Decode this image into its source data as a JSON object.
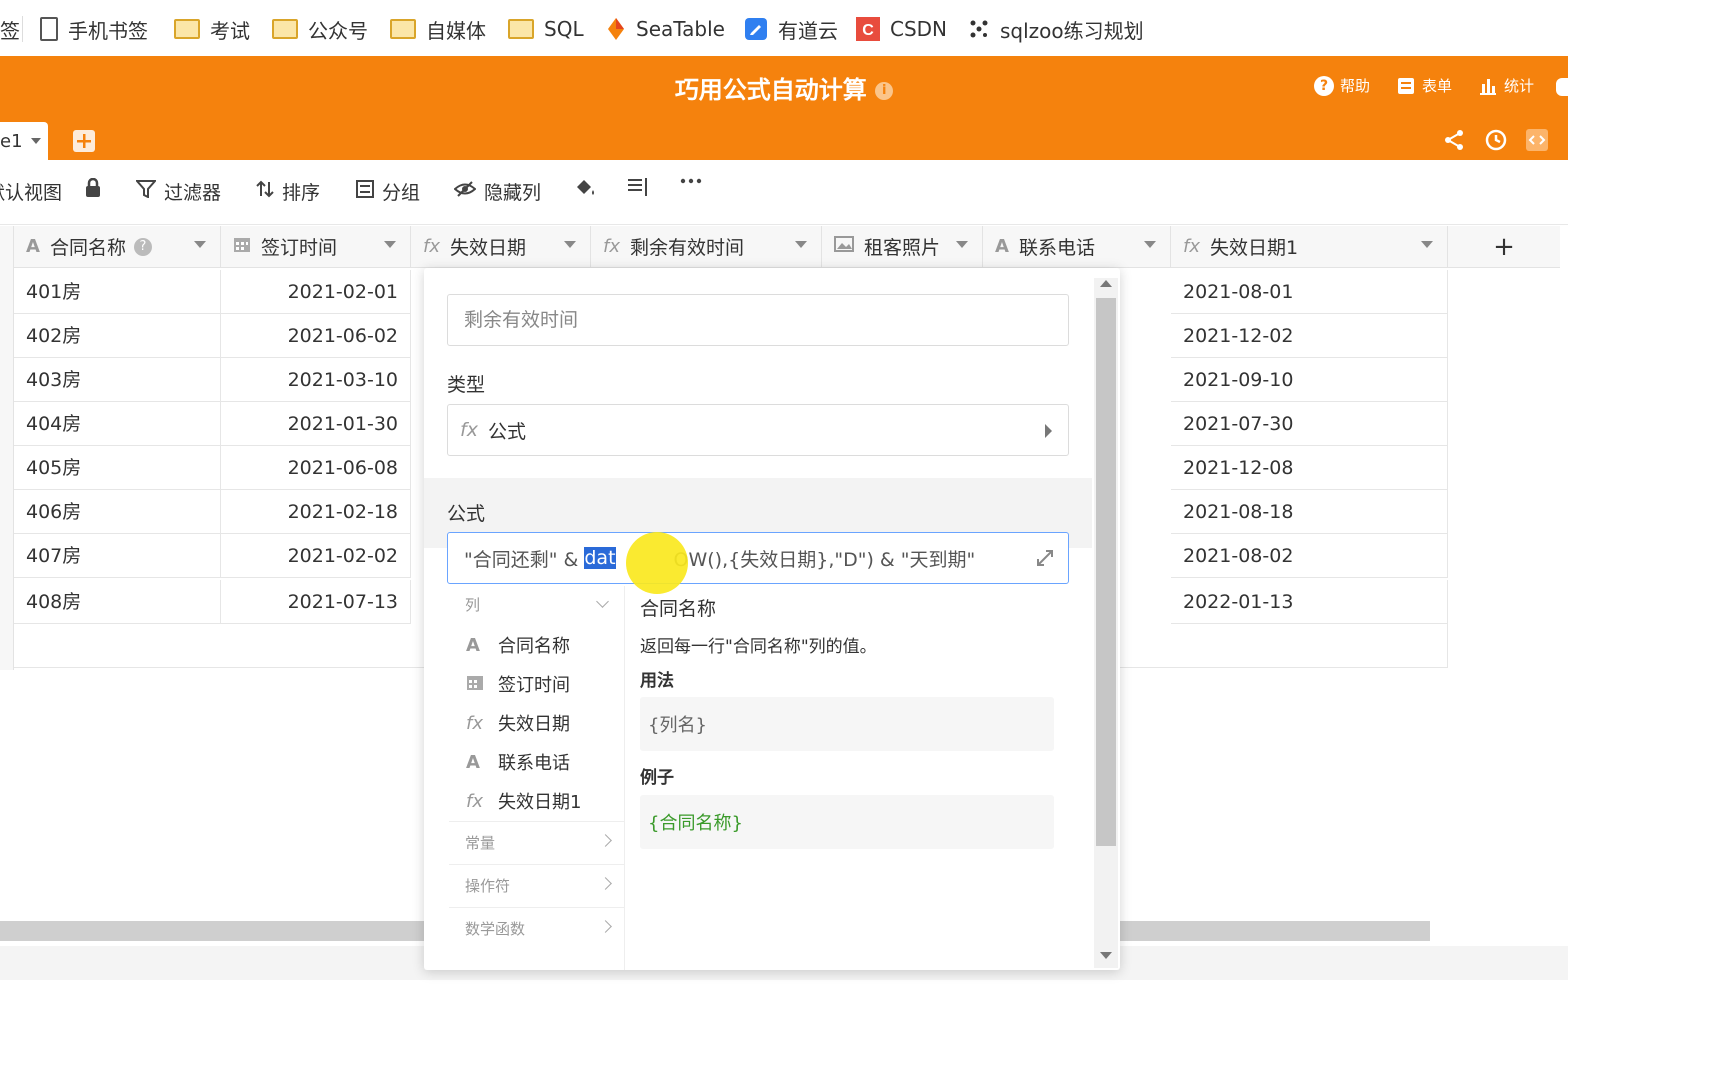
{
  "bookmarks": [
    {
      "label": "签",
      "icon": "bookmark-icon"
    },
    {
      "label": "手机书签",
      "icon": "phone-icon"
    },
    {
      "label": "考试",
      "icon": "folder-icon"
    },
    {
      "label": "公众号",
      "icon": "folder-icon"
    },
    {
      "label": "自媒体",
      "icon": "folder-icon"
    },
    {
      "label": "SQL",
      "icon": "folder-icon"
    },
    {
      "label": "SeaTable",
      "icon": "seatable-icon"
    },
    {
      "label": "有道云",
      "icon": "youdao-icon"
    },
    {
      "label": "CSDN",
      "icon": "csdn-icon"
    },
    {
      "label": "sqlzoo练习规划",
      "icon": "sqlzoo-icon"
    }
  ],
  "header": {
    "title": "巧用公式自动计算",
    "help": "帮助",
    "form": "表单",
    "stats": "统计",
    "table_tab": "e1",
    "colors": {
      "accent": "#f5820d"
    }
  },
  "toolbar": {
    "view": "默认视图",
    "filter": "过滤器",
    "sort": "排序",
    "group": "分组",
    "hide": "隐藏列"
  },
  "grid": {
    "columns": [
      {
        "label": "合同名称",
        "icon": "text-icon"
      },
      {
        "label": "签订时间",
        "icon": "calendar-icon"
      },
      {
        "label": "失效日期",
        "icon": "formula-icon"
      },
      {
        "label": "剩余有效时间",
        "icon": "formula-icon"
      },
      {
        "label": "租客照片",
        "icon": "image-icon"
      },
      {
        "label": "联系电话",
        "icon": "text-icon"
      },
      {
        "label": "失效日期1",
        "icon": "formula-icon"
      }
    ],
    "add_column": "+",
    "rows": [
      {
        "name": "401房",
        "signed": "2021-02-01",
        "expire1": "2021-08-01"
      },
      {
        "name": "402房",
        "signed": "2021-06-02",
        "expire1": "2021-12-02"
      },
      {
        "name": "403房",
        "signed": "2021-03-10",
        "expire1": "2021-09-10"
      },
      {
        "name": "404房",
        "signed": "2021-01-30",
        "expire1": "2021-07-30"
      },
      {
        "name": "405房",
        "signed": "2021-06-08",
        "expire1": "2021-12-08"
      },
      {
        "name": "406房",
        "signed": "2021-02-18",
        "expire1": "2021-08-18"
      },
      {
        "name": "407房",
        "signed": "2021-02-02",
        "expire1": "2021-08-02"
      },
      {
        "name": "408房",
        "signed": "2021-07-13",
        "expire1": "2022-01-13"
      }
    ]
  },
  "popup": {
    "column_name": "剩余有效时间",
    "type_label": "类型",
    "type_value": "公式",
    "formula_label": "公式",
    "formula_prefix": "\"合同还剩\" & ",
    "formula_selected": "dat",
    "formula_rest": "OW(),{失效日期},\"D\") & \"天到期\"",
    "menu_header": "列",
    "menu_items": [
      {
        "label": "合同名称",
        "icon": "text-icon"
      },
      {
        "label": "签订时间",
        "icon": "calendar-icon"
      },
      {
        "label": "失效日期",
        "icon": "formula-icon"
      },
      {
        "label": "联系电话",
        "icon": "text-icon"
      },
      {
        "label": "失效日期1",
        "icon": "formula-icon"
      }
    ],
    "sections": [
      "常量",
      "操作符",
      "数学函数"
    ],
    "detail_title": "合同名称",
    "detail_desc": "返回每一行\"合同名称\"列的值。",
    "usage_label": "用法",
    "usage_code": "{列名}",
    "example_label": "例子",
    "example_code": "{合同名称}"
  }
}
